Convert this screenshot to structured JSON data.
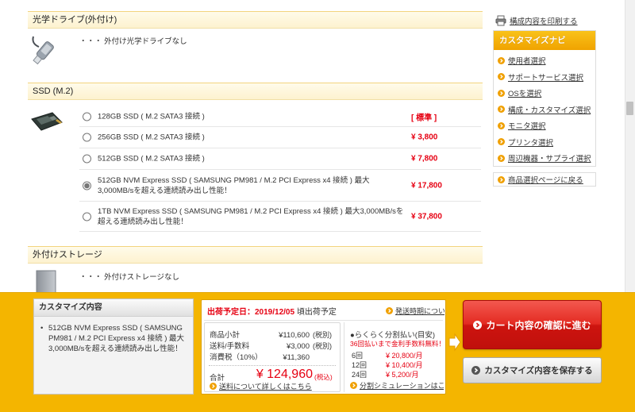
{
  "colors": {
    "accent_orange": "#f4b500",
    "price_red": "#e60012",
    "section_header_bg": "#fdf2cf",
    "cart_button": "#d81e16",
    "link": "#333333"
  },
  "icons": {
    "print": "printer-icon",
    "nav_bullet": "arrow-circle-icon",
    "proceed_arrow": "right-arrow-icon",
    "cart_button_icon": "arrow-circle-icon",
    "save_button_icon": "arrow-circle-icon"
  },
  "main": {
    "optical": {
      "title": "光学ドライブ(外付け)",
      "text": "・・・ 外付け光学ドライブなし"
    },
    "ssd": {
      "title": "SSD (M.2)",
      "options": [
        {
          "label": "128GB SSD ( M.2 SATA3 接続 )",
          "price": "[ 標準 ]",
          "selected": false
        },
        {
          "label": "256GB SSD ( M.2 SATA3 接続 )",
          "price": "¥ 3,800",
          "selected": false
        },
        {
          "label": "512GB SSD ( M.2 SATA3 接続 )",
          "price": "¥ 7,800",
          "selected": false
        },
        {
          "label": "512GB NVM Express SSD ( SAMSUNG PM981 / M.2 PCI Express x4 接続 ) 最大3,000MB/sを超える連続読み出し性能！",
          "price": "¥ 17,800",
          "selected": true
        },
        {
          "label": "1TB NVM Express SSD ( SAMSUNG PM981 / M.2 PCI Express x4 接続 ) 最大3,000MB/sを超える連続読み出し性能！",
          "price": "¥ 37,800",
          "selected": false
        }
      ]
    },
    "storage": {
      "title": "外付けストレージ",
      "text": "・・・ 外付けストレージなし"
    }
  },
  "sidebar": {
    "print_link": "構成内容を印刷する",
    "nav_title": "カスタマイズナビ",
    "nav_items": [
      "使用者選択",
      "サポートサービス選択",
      "OSを選択",
      "構成・カスタマイズ選択",
      "モニタ選択",
      "プリンタ選択",
      "周辺機器・サプライ選択"
    ],
    "back_link": "商品選択ページに戻る"
  },
  "footer": {
    "summary": {
      "title": "カスタマイズ内容",
      "items": [
        "512GB NVM Express SSD ( SAMSUNG PM981 / M.2 PCI Express x4 接続 ) 最大3,000MB/sを超える連続読み出し性能！"
      ]
    },
    "shipping": {
      "label": "出荷予定日：2019/12/05",
      "suffix": "頃出荷予定",
      "link": "発送時期について"
    },
    "prices": {
      "subtotal": {
        "label": "商品小計",
        "value": "¥110,600",
        "note": "(税別)"
      },
      "shipping_fee": {
        "label": "送料/手数料",
        "value": "¥3,000",
        "note": "(税別)"
      },
      "tax": {
        "label": "消費税（10%）",
        "value": "¥11,360"
      },
      "total": {
        "label": "合計",
        "value": "¥ 124,960",
        "note": "(税込)"
      },
      "link": "送料について詳しくはこちら"
    },
    "installments": {
      "title": "●らくらく分割払い(目安)",
      "promo": "36回払いまで金利手数料無料！",
      "rows": [
        {
          "count": "6回",
          "amount": "¥ 20,800/月"
        },
        {
          "count": "12回",
          "amount": "¥ 10,400/月"
        },
        {
          "count": "24回",
          "amount": "¥ 5,200/月"
        }
      ],
      "link": "分割シミュレーションはこちら"
    },
    "cart_button": "カート内容の確認に進む",
    "save_button": "カスタマイズ内容を保存する"
  }
}
